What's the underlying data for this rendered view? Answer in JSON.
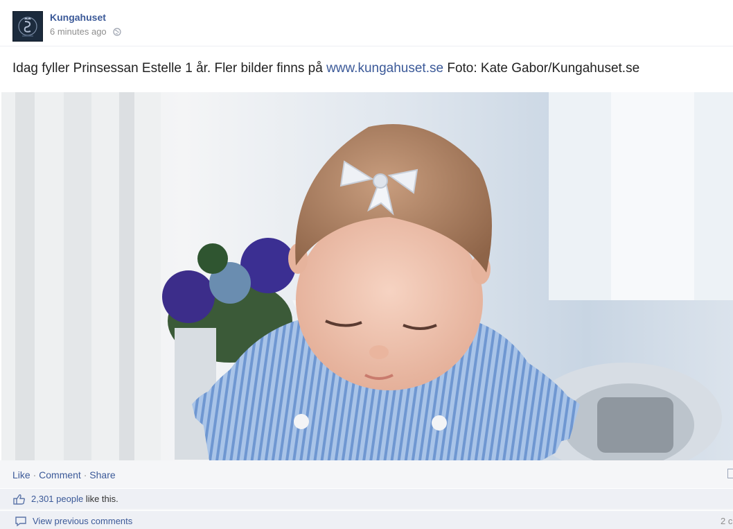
{
  "post": {
    "author": "Kungahuset",
    "timestamp": "6 minutes ago",
    "privacy_icon": "globe-icon",
    "message_before_link": "Idag fyller Prinsessan Estelle 1 år. Fler bilder finns på ",
    "message_link": "www.kungahuset.se",
    "message_after_link": " Foto: Kate Gabor/Kungahuset.se"
  },
  "actions": {
    "like": "Like",
    "separator": " · ",
    "comment": "Comment",
    "share": "Share"
  },
  "likes": {
    "count": "2,301 people",
    "suffix": " like this."
  },
  "comments": {
    "view_previous": "View previous comments",
    "count_partial": "2 c"
  },
  "colors": {
    "link": "#3b5998",
    "footer_bg": "#eef0f5",
    "avatar_bg": "#1c2b3d"
  }
}
